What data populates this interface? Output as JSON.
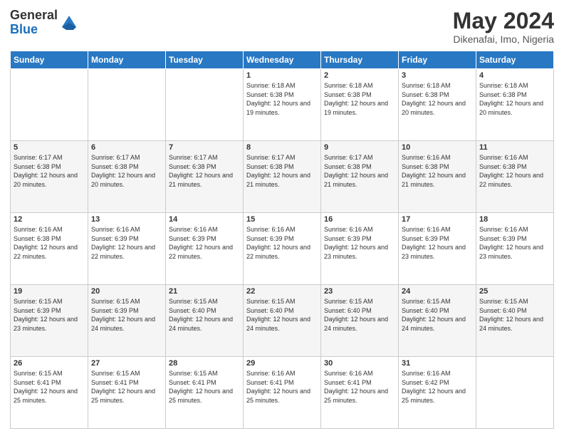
{
  "header": {
    "logo_general": "General",
    "logo_blue": "Blue",
    "month_title": "May 2024",
    "location": "Dikenafai, Imo, Nigeria"
  },
  "days_of_week": [
    "Sunday",
    "Monday",
    "Tuesday",
    "Wednesday",
    "Thursday",
    "Friday",
    "Saturday"
  ],
  "weeks": [
    [
      {
        "day": "",
        "info": ""
      },
      {
        "day": "",
        "info": ""
      },
      {
        "day": "",
        "info": ""
      },
      {
        "day": "1",
        "info": "Sunrise: 6:18 AM\nSunset: 6:38 PM\nDaylight: 12 hours and 19 minutes."
      },
      {
        "day": "2",
        "info": "Sunrise: 6:18 AM\nSunset: 6:38 PM\nDaylight: 12 hours and 19 minutes."
      },
      {
        "day": "3",
        "info": "Sunrise: 6:18 AM\nSunset: 6:38 PM\nDaylight: 12 hours and 20 minutes."
      },
      {
        "day": "4",
        "info": "Sunrise: 6:18 AM\nSunset: 6:38 PM\nDaylight: 12 hours and 20 minutes."
      }
    ],
    [
      {
        "day": "5",
        "info": "Sunrise: 6:17 AM\nSunset: 6:38 PM\nDaylight: 12 hours and 20 minutes."
      },
      {
        "day": "6",
        "info": "Sunrise: 6:17 AM\nSunset: 6:38 PM\nDaylight: 12 hours and 20 minutes."
      },
      {
        "day": "7",
        "info": "Sunrise: 6:17 AM\nSunset: 6:38 PM\nDaylight: 12 hours and 21 minutes."
      },
      {
        "day": "8",
        "info": "Sunrise: 6:17 AM\nSunset: 6:38 PM\nDaylight: 12 hours and 21 minutes."
      },
      {
        "day": "9",
        "info": "Sunrise: 6:17 AM\nSunset: 6:38 PM\nDaylight: 12 hours and 21 minutes."
      },
      {
        "day": "10",
        "info": "Sunrise: 6:16 AM\nSunset: 6:38 PM\nDaylight: 12 hours and 21 minutes."
      },
      {
        "day": "11",
        "info": "Sunrise: 6:16 AM\nSunset: 6:38 PM\nDaylight: 12 hours and 22 minutes."
      }
    ],
    [
      {
        "day": "12",
        "info": "Sunrise: 6:16 AM\nSunset: 6:38 PM\nDaylight: 12 hours and 22 minutes."
      },
      {
        "day": "13",
        "info": "Sunrise: 6:16 AM\nSunset: 6:39 PM\nDaylight: 12 hours and 22 minutes."
      },
      {
        "day": "14",
        "info": "Sunrise: 6:16 AM\nSunset: 6:39 PM\nDaylight: 12 hours and 22 minutes."
      },
      {
        "day": "15",
        "info": "Sunrise: 6:16 AM\nSunset: 6:39 PM\nDaylight: 12 hours and 22 minutes."
      },
      {
        "day": "16",
        "info": "Sunrise: 6:16 AM\nSunset: 6:39 PM\nDaylight: 12 hours and 23 minutes."
      },
      {
        "day": "17",
        "info": "Sunrise: 6:16 AM\nSunset: 6:39 PM\nDaylight: 12 hours and 23 minutes."
      },
      {
        "day": "18",
        "info": "Sunrise: 6:16 AM\nSunset: 6:39 PM\nDaylight: 12 hours and 23 minutes."
      }
    ],
    [
      {
        "day": "19",
        "info": "Sunrise: 6:15 AM\nSunset: 6:39 PM\nDaylight: 12 hours and 23 minutes."
      },
      {
        "day": "20",
        "info": "Sunrise: 6:15 AM\nSunset: 6:39 PM\nDaylight: 12 hours and 24 minutes."
      },
      {
        "day": "21",
        "info": "Sunrise: 6:15 AM\nSunset: 6:40 PM\nDaylight: 12 hours and 24 minutes."
      },
      {
        "day": "22",
        "info": "Sunrise: 6:15 AM\nSunset: 6:40 PM\nDaylight: 12 hours and 24 minutes."
      },
      {
        "day": "23",
        "info": "Sunrise: 6:15 AM\nSunset: 6:40 PM\nDaylight: 12 hours and 24 minutes."
      },
      {
        "day": "24",
        "info": "Sunrise: 6:15 AM\nSunset: 6:40 PM\nDaylight: 12 hours and 24 minutes."
      },
      {
        "day": "25",
        "info": "Sunrise: 6:15 AM\nSunset: 6:40 PM\nDaylight: 12 hours and 24 minutes."
      }
    ],
    [
      {
        "day": "26",
        "info": "Sunrise: 6:15 AM\nSunset: 6:41 PM\nDaylight: 12 hours and 25 minutes."
      },
      {
        "day": "27",
        "info": "Sunrise: 6:15 AM\nSunset: 6:41 PM\nDaylight: 12 hours and 25 minutes."
      },
      {
        "day": "28",
        "info": "Sunrise: 6:15 AM\nSunset: 6:41 PM\nDaylight: 12 hours and 25 minutes."
      },
      {
        "day": "29",
        "info": "Sunrise: 6:16 AM\nSunset: 6:41 PM\nDaylight: 12 hours and 25 minutes."
      },
      {
        "day": "30",
        "info": "Sunrise: 6:16 AM\nSunset: 6:41 PM\nDaylight: 12 hours and 25 minutes."
      },
      {
        "day": "31",
        "info": "Sunrise: 6:16 AM\nSunset: 6:42 PM\nDaylight: 12 hours and 25 minutes."
      },
      {
        "day": "",
        "info": ""
      }
    ]
  ]
}
